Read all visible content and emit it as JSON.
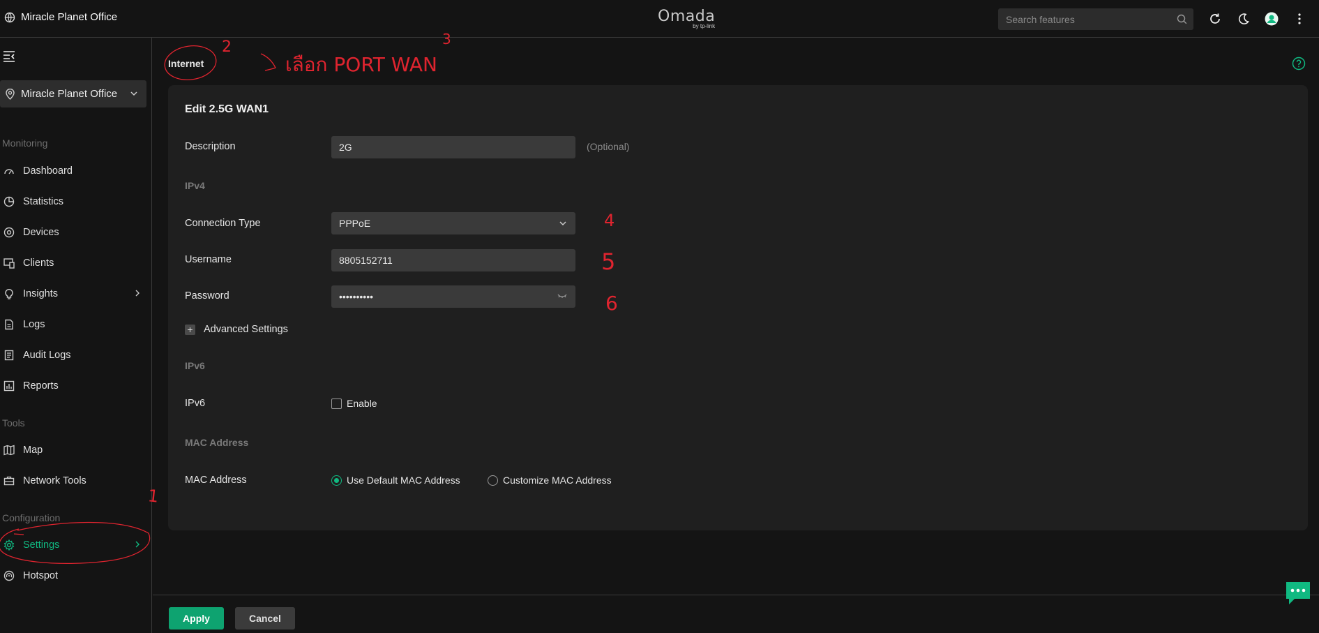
{
  "topbar": {
    "site_name": "Miracle Planet Office",
    "logo_main": "Omada",
    "logo_sub": "by tp-link",
    "search_placeholder": "Search features"
  },
  "sidebar": {
    "site_selector": "Miracle Planet Office",
    "sections": {
      "monitoring": "Monitoring",
      "tools": "Tools",
      "configuration": "Configuration"
    },
    "items": [
      {
        "label": "Dashboard",
        "icon": "dashboard-icon"
      },
      {
        "label": "Statistics",
        "icon": "pie-chart-icon"
      },
      {
        "label": "Devices",
        "icon": "devices-icon"
      },
      {
        "label": "Clients",
        "icon": "clients-icon"
      },
      {
        "label": "Insights",
        "icon": "lightbulb-icon"
      },
      {
        "label": "Logs",
        "icon": "document-icon"
      },
      {
        "label": "Audit Logs",
        "icon": "audit-log-icon"
      },
      {
        "label": "Reports",
        "icon": "bar-chart-icon"
      },
      {
        "label": "Map",
        "icon": "map-icon"
      },
      {
        "label": "Network Tools",
        "icon": "toolbox-icon"
      },
      {
        "label": "Settings",
        "icon": "gear-icon",
        "active": true
      },
      {
        "label": "Hotspot",
        "icon": "hotspot-icon"
      }
    ]
  },
  "main": {
    "page_title": "Internet",
    "card_title": "Edit 2.5G WAN1",
    "description": {
      "label": "Description",
      "value": "2G",
      "hint": "(Optional)"
    },
    "ipv4_heading": "IPv4",
    "connection_type": {
      "label": "Connection Type",
      "value": "PPPoE"
    },
    "username": {
      "label": "Username",
      "value": "8805152711"
    },
    "password": {
      "label": "Password",
      "value": "••••••••••"
    },
    "advanced_settings": "Advanced Settings",
    "ipv6_heading": "IPv6",
    "ipv6": {
      "label": "IPv6",
      "checkbox_label": "Enable",
      "checked": false
    },
    "mac_heading": "MAC Address",
    "mac": {
      "label": "MAC Address",
      "options": [
        "Use Default MAC Address",
        "Customize MAC Address"
      ],
      "selected": "Use Default MAC Address"
    }
  },
  "footer": {
    "apply": "Apply",
    "cancel": "Cancel"
  },
  "annotations": {
    "instruction": "เลือก PORT WAN",
    "step_numbers": [
      "1",
      "2",
      "3",
      "4",
      "5",
      "6"
    ]
  },
  "colors": {
    "accent": "#10b981",
    "annotation": "#e0242f",
    "background": "#141414",
    "card": "#1f1f1f"
  }
}
